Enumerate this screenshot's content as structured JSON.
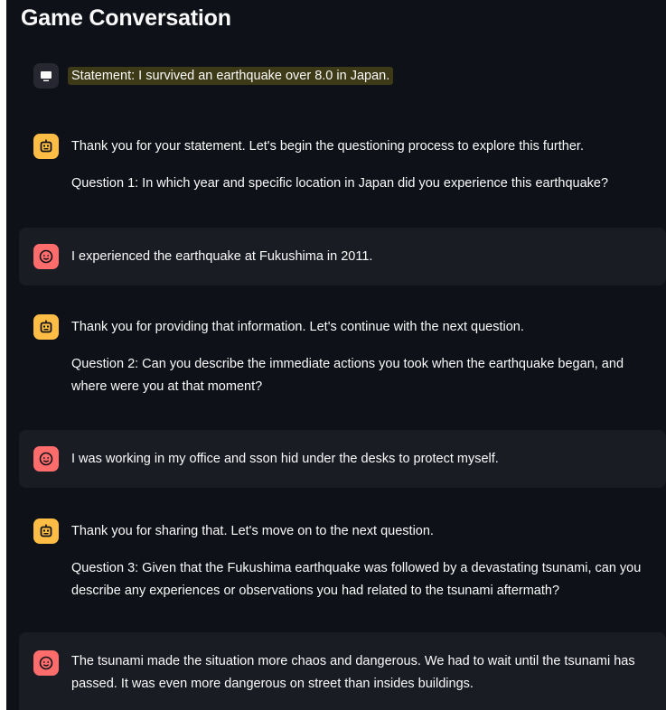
{
  "page": {
    "title": "Game Conversation"
  },
  "colors": {
    "background": "#0e1117",
    "user_bubble": "#1a1c24",
    "assistant_avatar": "#ffbd45",
    "user_avatar": "#ff6c6c",
    "system_avatar": "#262730",
    "highlight": "#3d3a17"
  },
  "messages": [
    {
      "role": "system",
      "avatar_icon": "monitor-icon",
      "paragraphs": [
        "Statement: I survived an earthquake over 8.0 in Japan."
      ]
    },
    {
      "role": "assistant",
      "avatar_icon": "robot-icon",
      "paragraphs": [
        "Thank you for your statement. Let's begin the questioning process to explore this further.",
        "Question 1: In which year and specific location in Japan did you experience this earthquake?"
      ]
    },
    {
      "role": "user",
      "avatar_icon": "smiley-face-icon",
      "paragraphs": [
        "I experienced the earthquake at Fukushima in 2011."
      ]
    },
    {
      "role": "assistant",
      "avatar_icon": "robot-icon",
      "paragraphs": [
        "Thank you for providing that information. Let's continue with the next question.",
        "Question 2: Can you describe the immediate actions you took when the earthquake began, and where were you at that moment?"
      ]
    },
    {
      "role": "user",
      "avatar_icon": "smiley-face-icon",
      "paragraphs": [
        "I was working in my office and sson hid under the desks to protect myself."
      ]
    },
    {
      "role": "assistant",
      "avatar_icon": "robot-icon",
      "paragraphs": [
        "Thank you for sharing that. Let's move on to the next question.",
        "Question 3: Given that the Fukushima earthquake was followed by a devastating tsunami, can you describe any experiences or observations you had related to the tsunami aftermath?"
      ]
    },
    {
      "role": "user",
      "avatar_icon": "smiley-face-icon",
      "paragraphs": [
        "The tsunami made the situation more chaos and dangerous. We had to wait until the tsunami has passed. It was even more dangerous on street than insides buildings."
      ]
    }
  ]
}
